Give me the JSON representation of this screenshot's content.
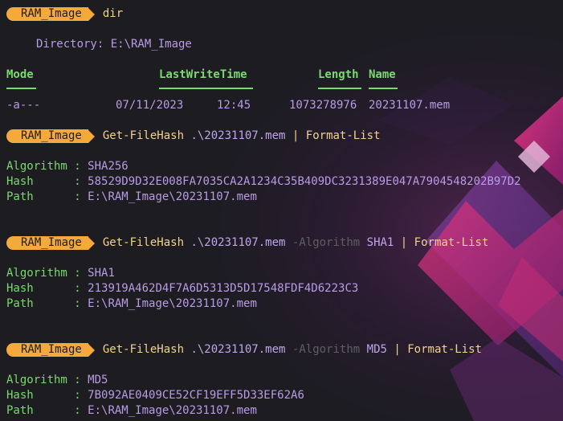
{
  "prompt": {
    "label": "RAM_Image"
  },
  "commands": [
    {
      "cmd": "dir",
      "output": {
        "directory_label": "Directory: E:\\RAM_Image",
        "columns": [
          "Mode",
          "LastWriteTime",
          "Length",
          "Name"
        ],
        "rows": [
          {
            "mode": "-a---",
            "date": "07/11/2023",
            "time": "12:45",
            "length": "1073278976",
            "name": "20231107.mem"
          }
        ]
      }
    },
    {
      "cmdlet": "Get-FileHash",
      "arg": ".\\20231107.mem",
      "pipe": "|",
      "format": "Format-List",
      "result": {
        "algorithm_label": "Algorithm :",
        "algorithm": "SHA256",
        "hash_label": "Hash      :",
        "hash": "58529D9D32E008FA7035CA2A1234C35B409DC3231389E047A7904548202B97D2",
        "path_label": "Path      :",
        "path": "E:\\RAM_Image\\20231107.mem"
      }
    },
    {
      "cmdlet": "Get-FileHash",
      "arg": ".\\20231107.mem",
      "param": "-Algorithm",
      "param_value": "SHA1",
      "pipe": "|",
      "format": "Format-List",
      "result": {
        "algorithm_label": "Algorithm :",
        "algorithm": "SHA1",
        "hash_label": "Hash      :",
        "hash": "213919A462D4F7A6D5313D5D17548FDF4D6223C3",
        "path_label": "Path      :",
        "path": "E:\\RAM_Image\\20231107.mem"
      }
    },
    {
      "cmdlet": "Get-FileHash",
      "arg": ".\\20231107.mem",
      "param": "-Algorithm",
      "param_value": "MD5",
      "pipe": "|",
      "format": "Format-List",
      "result": {
        "algorithm_label": "Algorithm :",
        "algorithm": "MD5",
        "hash_label": "Hash      :",
        "hash": "7B092AE0409CE52CF19EFF5D33EF62A6",
        "path_label": "Path      :",
        "path": "E:\\RAM_Image\\20231107.mem"
      }
    }
  ],
  "colors": {
    "background": "#1c1c21",
    "prompt_pill": "#f3a93c",
    "command": "#f2d28f",
    "output": "#c0a5ea",
    "labels": "#7bd96f",
    "parameter": "#5f5f5f",
    "accent_magenta": "#d8347f"
  }
}
